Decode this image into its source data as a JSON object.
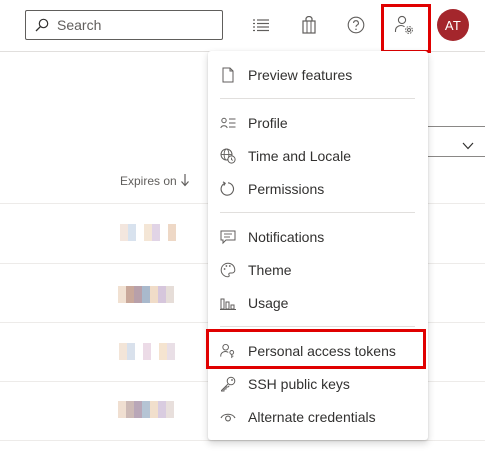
{
  "header": {
    "search": {
      "placeholder": "Search",
      "value": ""
    },
    "icons": [
      "task-list-icon",
      "marketplace-bag-icon",
      "help-icon",
      "user-settings-icon"
    ],
    "avatar_initials": "AT",
    "avatar_color": "#a4262c",
    "highlight_color": "#e00000"
  },
  "page": {
    "column_header": "Expires on"
  },
  "user_menu": {
    "groups": [
      {
        "items": [
          {
            "label": "Preview features",
            "icon": "document-icon"
          }
        ]
      },
      {
        "items": [
          {
            "label": "Profile",
            "icon": "contact-card-icon"
          },
          {
            "label": "Time and Locale",
            "icon": "globe-clock-icon"
          },
          {
            "label": "Permissions",
            "icon": "refresh-circle-icon"
          }
        ]
      },
      {
        "items": [
          {
            "label": "Notifications",
            "icon": "chat-bubble-icon"
          },
          {
            "label": "Theme",
            "icon": "palette-icon"
          },
          {
            "label": "Usage",
            "icon": "bar-chart-icon"
          }
        ]
      },
      {
        "items": [
          {
            "label": "Personal access tokens",
            "icon": "person-key-icon",
            "highlighted": true
          },
          {
            "label": "SSH public keys",
            "icon": "key-icon"
          },
          {
            "label": "Alternate credentials",
            "icon": "eye-icon"
          }
        ]
      }
    ]
  }
}
